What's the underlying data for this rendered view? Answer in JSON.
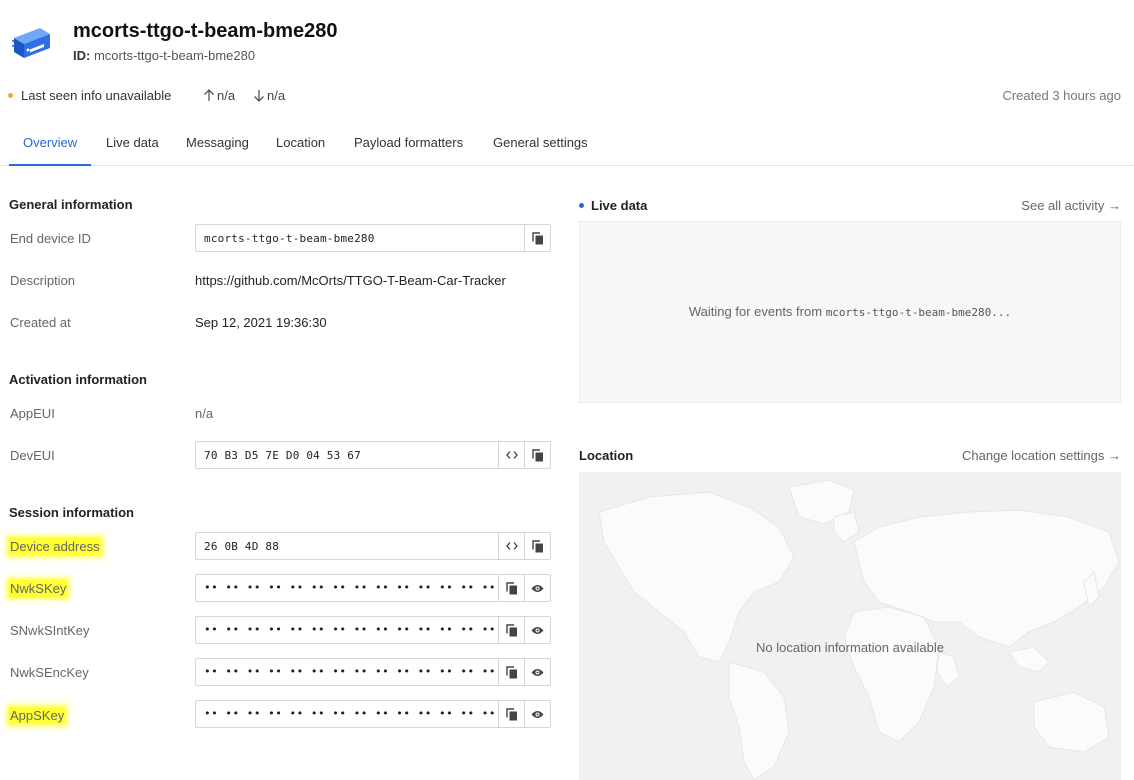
{
  "header": {
    "title": "mcorts-ttgo-t-beam-bme280",
    "id_label": "ID:",
    "id_value": "mcorts-ttgo-t-beam-bme280"
  },
  "status": {
    "last_seen": "Last seen info unavailable",
    "uplink": "n/a",
    "downlink": "n/a",
    "created": "Created 3 hours ago",
    "dot_color": "#f0a92e"
  },
  "tabs": [
    {
      "label": "Overview",
      "active": true
    },
    {
      "label": "Live data",
      "active": false
    },
    {
      "label": "Messaging",
      "active": false
    },
    {
      "label": "Location",
      "active": false
    },
    {
      "label": "Payload formatters",
      "active": false
    },
    {
      "label": "General settings",
      "active": false
    }
  ],
  "general": {
    "title": "General information",
    "end_device_id_label": "End device ID",
    "end_device_id": "mcorts-ttgo-t-beam-bme280",
    "description_label": "Description",
    "description": "https://github.com/McOrts/TTGO-T-Beam-Car-Tracker",
    "created_at_label": "Created at",
    "created_at": "Sep 12, 2021 19:36:30"
  },
  "activation": {
    "title": "Activation information",
    "appeui_label": "AppEUI",
    "appeui": "n/a",
    "deveui_label": "DevEUI",
    "deveui": "70 B3 D5 7E D0 04 53 67"
  },
  "session": {
    "title": "Session information",
    "device_address_label": "Device address",
    "device_address": "26 0B 4D 88",
    "nwkskey_label": "NwkSKey",
    "snwksintkey_label": "SNwkSIntKey",
    "nwksenckey_label": "NwkSEncKey",
    "appskey_label": "AppSKey",
    "masked_value": "•• •• •• •• •• •• •• •• •• •• •• •• •• •• •• •• ••"
  },
  "live_data": {
    "title": "Live data",
    "link": "See all activity →",
    "waiting_prefix": "Waiting for events from",
    "waiting_device": "mcorts-ttgo-t-beam-bme280...",
    "dot_color": "#2869d8"
  },
  "location": {
    "title": "Location",
    "link": "Change location settings →",
    "empty_text": "No location information available"
  },
  "colors": {
    "accent": "#2869d8",
    "highlight": "#ffff33"
  }
}
